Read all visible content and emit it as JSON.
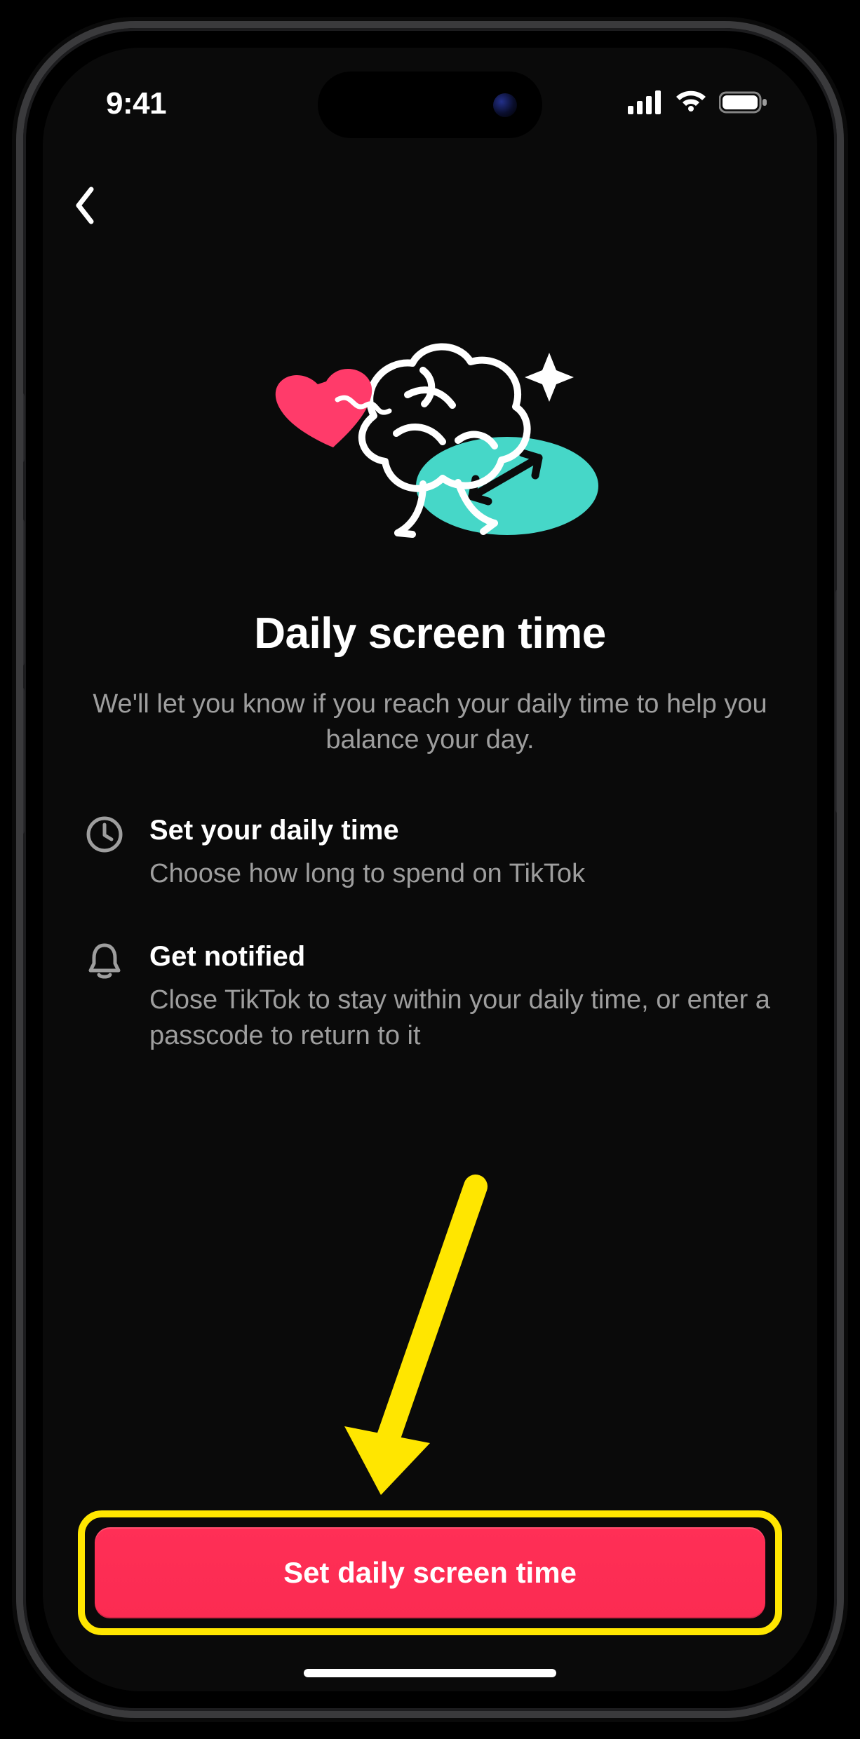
{
  "status": {
    "time": "9:41"
  },
  "page": {
    "title": "Daily screen time",
    "subtitle": "We'll let you know if you reach your daily time to help you balance your day."
  },
  "features": [
    {
      "title": "Set your daily time",
      "desc": "Choose how long to spend on TikTok"
    },
    {
      "title": "Get notified",
      "desc": "Close TikTok to stay within your daily time, or enter a passcode to return to it"
    }
  ],
  "cta": {
    "label": "Set daily screen time"
  },
  "colors": {
    "accent": "#ff2f56",
    "highlight": "#ffe600",
    "teal": "#46d7c8",
    "pink": "#ff3b6a",
    "bg": "#0a0a0a"
  }
}
